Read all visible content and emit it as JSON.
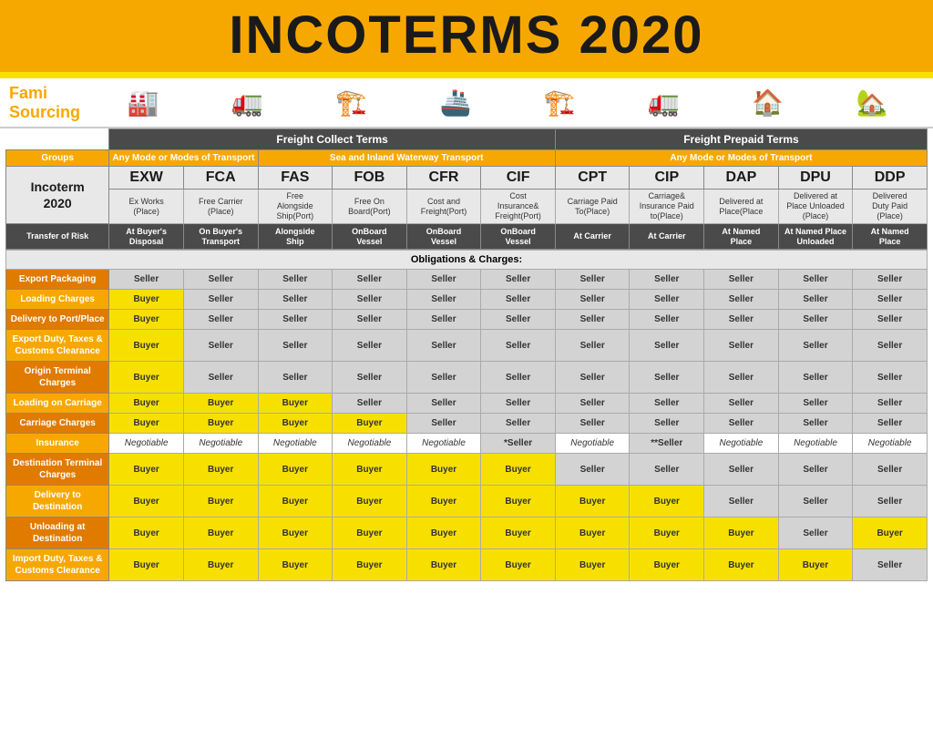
{
  "header": {
    "title": "INCOTERMS 2020"
  },
  "logo": {
    "line1": "Fami",
    "line2": "Sourcing"
  },
  "freight": {
    "collect": "Freight Collect Terms",
    "prepaid": "Freight Prepaid Terms"
  },
  "transport": {
    "any1": "Any Mode or Modes of Transport",
    "sea": "Sea and Inland Waterway Transport",
    "any2": "Any Mode or Modes of Transport"
  },
  "incoterms": [
    {
      "abbr": "EXW",
      "full": "Ex Works\n(Place)"
    },
    {
      "abbr": "FCA",
      "full": "Free Carrier\n(Place)"
    },
    {
      "abbr": "FAS",
      "full": "Free\nAlongside\nShip(Port)"
    },
    {
      "abbr": "FOB",
      "full": "Free On\nBoard(Port)"
    },
    {
      "abbr": "CFR",
      "full": "Cost and\nFreight(Port)"
    },
    {
      "abbr": "CIF",
      "full": "Cost\nInsurance&\nFreight(Port)"
    },
    {
      "abbr": "CPT",
      "full": "Carriage Paid\nTo(Place)"
    },
    {
      "abbr": "CIP",
      "full": "Carriage&\nInsurance Paid\nto(Place)"
    },
    {
      "abbr": "DAP",
      "full": "Delivered at\nPlace(Place"
    },
    {
      "abbr": "DPU",
      "full": "Delivered at\nPlace Unloaded\n(Place)"
    },
    {
      "abbr": "DDP",
      "full": "Delivered\nDuty Paid\n(Place)"
    }
  ],
  "risk_labels": [
    "At Buyer's\nDisposal",
    "On Buyer's\nTransport",
    "Alongside\nShip",
    "OnBoard\nVessel",
    "OnBoard\nVessel",
    "OnBoard\nVessel",
    "At Carrier",
    "At Carrier",
    "At Named\nPlace",
    "At Named Place\nUnloaded",
    "At Named\nPlace"
  ],
  "rows": [
    {
      "label": "Export Packaging",
      "values": [
        "Seller",
        "Seller",
        "Seller",
        "Seller",
        "Seller",
        "Seller",
        "Seller",
        "Seller",
        "Seller",
        "Seller",
        "Seller"
      ]
    },
    {
      "label": "Loading Charges",
      "values": [
        "Buyer",
        "Seller",
        "Seller",
        "Seller",
        "Seller",
        "Seller",
        "Seller",
        "Seller",
        "Seller",
        "Seller",
        "Seller"
      ]
    },
    {
      "label": "Delivery to Port/Place",
      "values": [
        "Buyer",
        "Seller",
        "Seller",
        "Seller",
        "Seller",
        "Seller",
        "Seller",
        "Seller",
        "Seller",
        "Seller",
        "Seller"
      ]
    },
    {
      "label": "Export Duty, Taxes & Customs Clearance",
      "values": [
        "Buyer",
        "Seller",
        "Seller",
        "Seller",
        "Seller",
        "Seller",
        "Seller",
        "Seller",
        "Seller",
        "Seller",
        "Seller"
      ]
    },
    {
      "label": "Origin Terminal Charges",
      "values": [
        "Buyer",
        "Seller",
        "Seller",
        "Seller",
        "Seller",
        "Seller",
        "Seller",
        "Seller",
        "Seller",
        "Seller",
        "Seller"
      ]
    },
    {
      "label": "Loading on Carriage",
      "values": [
        "Buyer",
        "Buyer",
        "Buyer",
        "Seller",
        "Seller",
        "Seller",
        "Seller",
        "Seller",
        "Seller",
        "Seller",
        "Seller"
      ]
    },
    {
      "label": "Carriage Charges",
      "values": [
        "Buyer",
        "Buyer",
        "Buyer",
        "Buyer",
        "Seller",
        "Seller",
        "Seller",
        "Seller",
        "Seller",
        "Seller",
        "Seller"
      ]
    },
    {
      "label": "Insurance",
      "values": [
        "Negotiable",
        "Negotiable",
        "Negotiable",
        "Negotiable",
        "Negotiable",
        "*Seller",
        "Negotiable",
        "**Seller",
        "Negotiable",
        "Negotiable",
        "Negotiable"
      ]
    },
    {
      "label": "Destination Terminal Charges",
      "values": [
        "Buyer",
        "Buyer",
        "Buyer",
        "Buyer",
        "Buyer",
        "Buyer",
        "Seller",
        "Seller",
        "Seller",
        "Seller",
        "Seller"
      ]
    },
    {
      "label": "Delivery to Destination",
      "values": [
        "Buyer",
        "Buyer",
        "Buyer",
        "Buyer",
        "Buyer",
        "Buyer",
        "Buyer",
        "Buyer",
        "Seller",
        "Seller",
        "Seller"
      ]
    },
    {
      "label": "Unloading at Destination",
      "values": [
        "Buyer",
        "Buyer",
        "Buyer",
        "Buyer",
        "Buyer",
        "Buyer",
        "Buyer",
        "Buyer",
        "Buyer",
        "Seller",
        "Buyer"
      ]
    },
    {
      "label": "Import Duty, Taxes & Customs Clearance",
      "values": [
        "Buyer",
        "Buyer",
        "Buyer",
        "Buyer",
        "Buyer",
        "Buyer",
        "Buyer",
        "Buyer",
        "Buyer",
        "Buyer",
        "Seller"
      ]
    }
  ],
  "labels": {
    "groups": "Groups",
    "incoterm2020": "Incoterm\n2020",
    "transfer_of_risk": "Transfer of Risk",
    "obligations": "Obligations & Charges:"
  }
}
